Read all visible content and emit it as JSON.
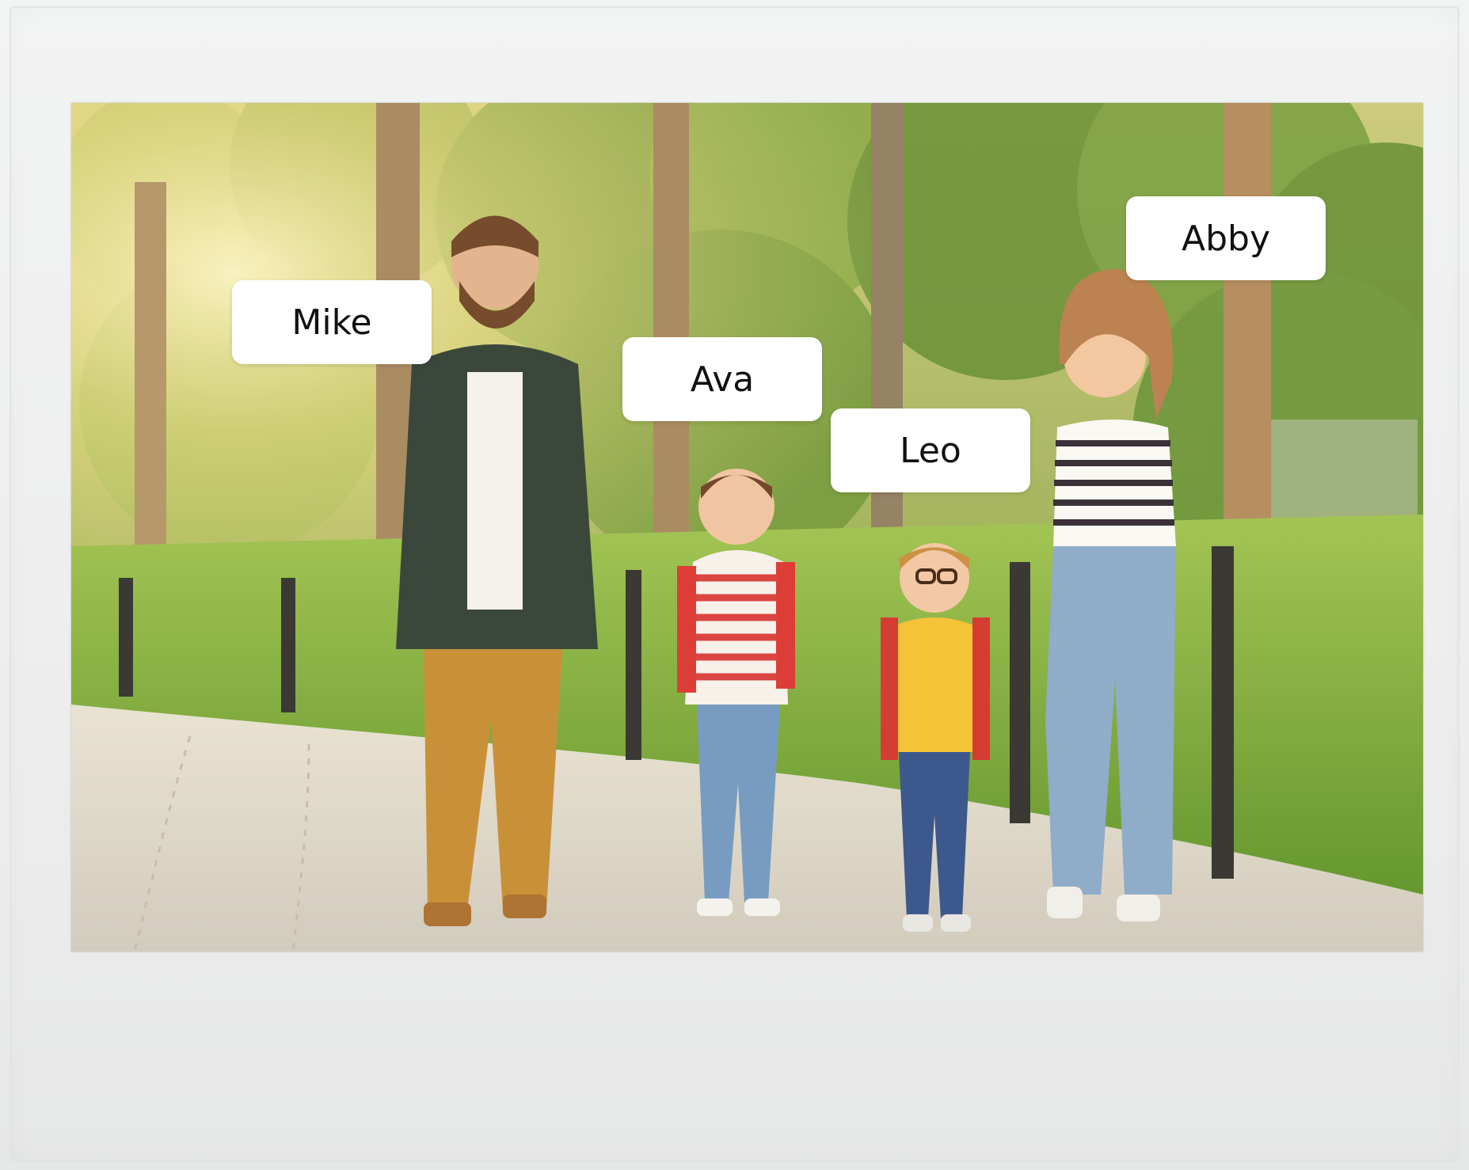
{
  "photo": {
    "labels": {
      "mike": "Mike",
      "ava": "Ava",
      "leo": "Leo",
      "abby": "Abby"
    }
  },
  "colors": {
    "frame": "#efefef",
    "label_bg": "#ffffff",
    "label_text": "#111111",
    "foliage": "#7fa838",
    "sunlight": "#f6e9a0",
    "path": "#d9d6cf",
    "grass": "#7fb53a"
  }
}
